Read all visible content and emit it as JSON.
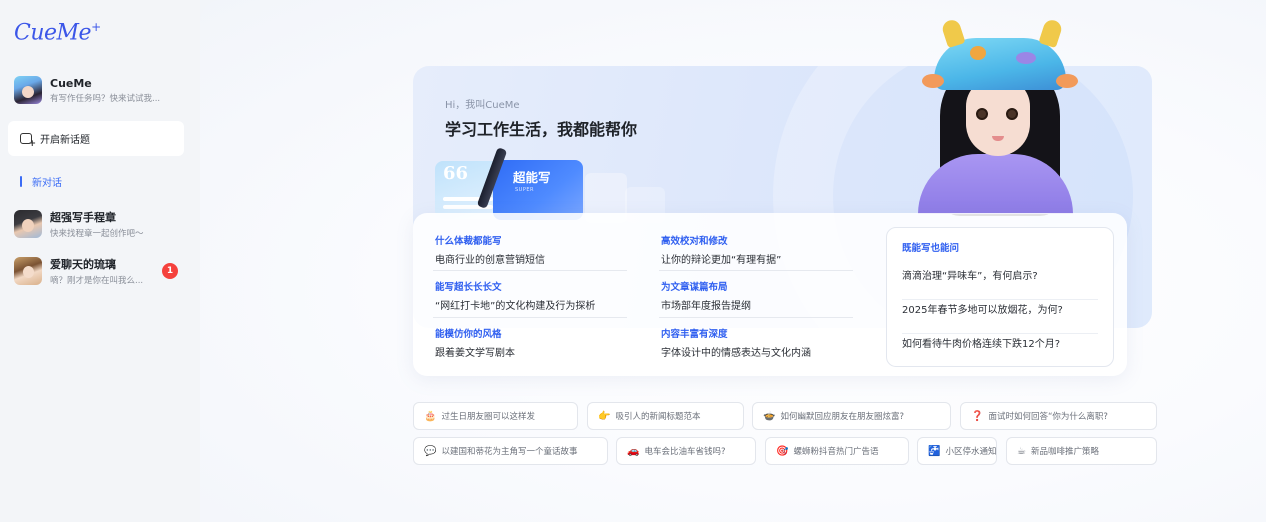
{
  "sidebar": {
    "logo": "CueMe",
    "logo_star": "+",
    "profile": {
      "name": "CueMe",
      "subtitle": "有写作任务吗？快来试试我..."
    },
    "new_topic_label": "开启新话题",
    "new_chat_label": "新对话",
    "chats": [
      {
        "name": "超强写手程章",
        "preview": "快来找程章一起创作吧～",
        "badge": ""
      },
      {
        "name": "爱聊天的琉璃",
        "preview": "嘀？刚才是你在叫我么...",
        "badge": "1"
      }
    ]
  },
  "hero": {
    "greeting": "Hi，我叫CueMe",
    "title": "学习工作生活，我都能帮你",
    "card_label": "超能写",
    "card_sub": "SUPER"
  },
  "features": [
    {
      "title": "什么体裁都能写",
      "desc": "电商行业的创意营销短信"
    },
    {
      "title": "能写超长长长文",
      "desc": "“网红打卡地”的文化构建及行为探析"
    },
    {
      "title": "能模仿你的风格",
      "desc": "跟着姜文学写剧本"
    },
    {
      "title": "高效校对和修改",
      "desc": "让你的辩论更加“有理有据”"
    },
    {
      "title": "为文章谋篇布局",
      "desc": "市场部年度报告提纲"
    },
    {
      "title": "内容丰富有深度",
      "desc": "字体设计中的情感表达与文化内涵"
    }
  ],
  "questions": {
    "title": "既能写也能问",
    "items": [
      "滴滴治理“异味车”，有何启示?",
      "2025年春节多地可以放烟花，为何?",
      "如何看待牛肉价格连续下跌12个月?"
    ]
  },
  "suggestions": [
    {
      "icon": "🎂",
      "icon_name": "cake-icon",
      "label": "过生日朋友圈可以这样发"
    },
    {
      "icon": "👉",
      "icon_name": "pointing-hand-icon",
      "label": "吸引人的新闻标题范本"
    },
    {
      "icon": "🍲",
      "icon_name": "pot-icon",
      "label": "如何幽默回应朋友在朋友圈炫富?"
    },
    {
      "icon": "❓",
      "icon_name": "question-icon",
      "label": "面试时如何回答“你为什么离职?"
    },
    {
      "icon": "💬",
      "icon_name": "speech-bubble-icon",
      "label": "以建国和蒂花为主角写一个童话故事"
    },
    {
      "icon": "🚗",
      "icon_name": "car-icon",
      "label": "电车会比油车省钱吗?"
    },
    {
      "icon": "🎯",
      "icon_name": "target-icon",
      "label": "螺蛳粉抖音热门广告语"
    },
    {
      "icon": "🚰",
      "icon_name": "water-tap-icon",
      "label": "小区停水通知"
    },
    {
      "icon": "☕",
      "icon_name": "coffee-icon",
      "label": "新品咖啡推广策略"
    }
  ],
  "colors": {
    "accent": "#3b6cf5",
    "badge": "#f5413d",
    "sidebar_bg": "#f3f5f8"
  }
}
